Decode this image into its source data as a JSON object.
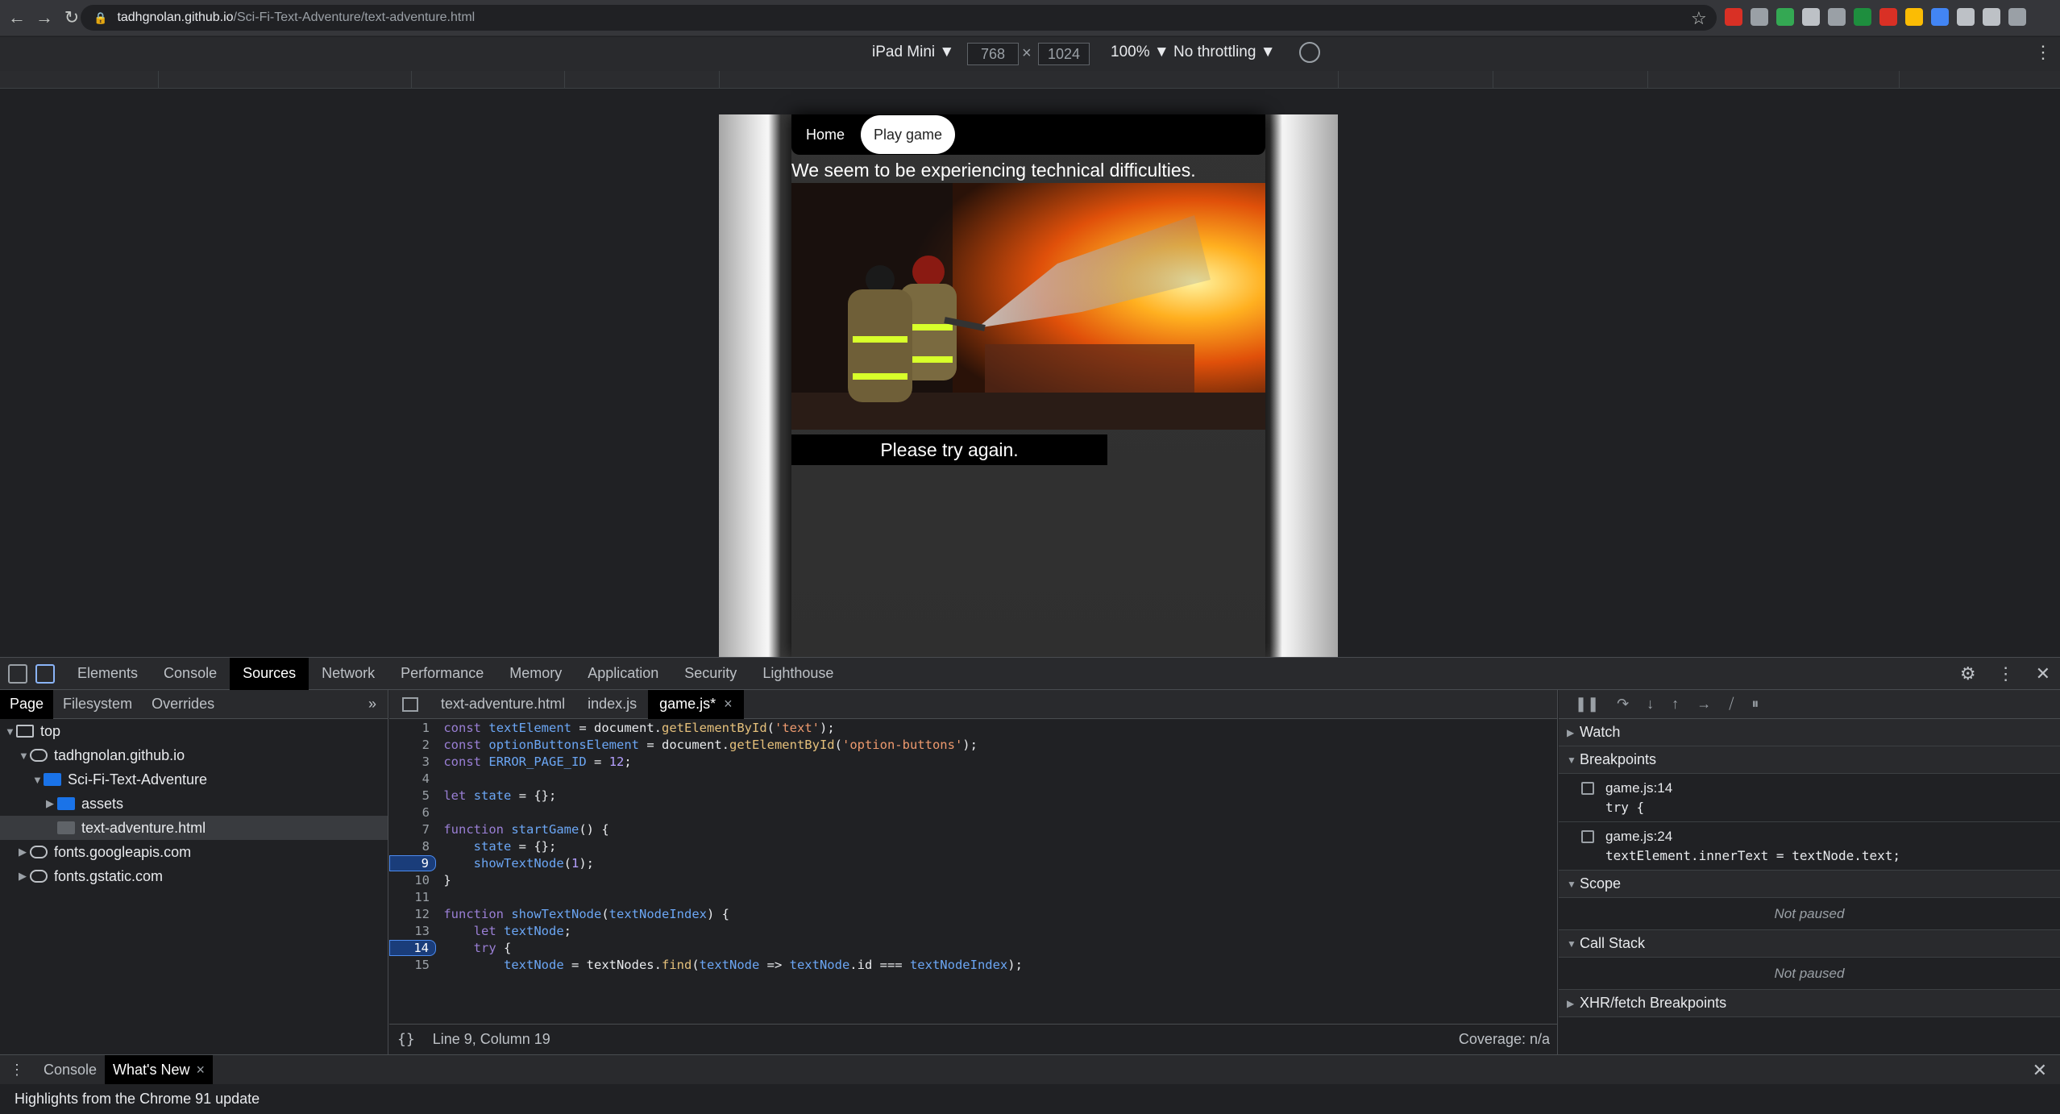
{
  "browser": {
    "url_host": "tadhgnolan.github.io",
    "url_path": "/Sci-Fi-Text-Adventure/text-adventure.html",
    "extension_colors": [
      "#d93025",
      "#9aa0a6",
      "#34a853",
      "#bdc1c6",
      "#9aa0a6",
      "#1e8e3e",
      "#d93025",
      "#fbbc04",
      "#4285f4",
      "#bdc1c6",
      "#bdc1c6",
      "#9aa0a6"
    ]
  },
  "device_toolbar": {
    "device": "iPad Mini ▼",
    "width": "768",
    "height": "1024",
    "times": "×",
    "zoom": "100% ▼",
    "throttling": "No throttling ▼"
  },
  "game": {
    "nav_home": "Home",
    "nav_play": "Play game",
    "message": "We seem to be experiencing technical difficulties.",
    "retry": "Please try again."
  },
  "devtools": {
    "tabs": [
      "Elements",
      "Console",
      "Sources",
      "Network",
      "Performance",
      "Memory",
      "Application",
      "Security",
      "Lighthouse"
    ],
    "active_tab": "Sources",
    "navigator_tabs": [
      "Page",
      "Filesystem",
      "Overrides",
      "»"
    ],
    "tree": [
      {
        "label": "top",
        "depth": 0,
        "icon": "frame",
        "arrow": "▼"
      },
      {
        "label": "tadhgnolan.github.io",
        "depth": 1,
        "icon": "cloud",
        "arrow": "▼"
      },
      {
        "label": "Sci-Fi-Text-Adventure",
        "depth": 2,
        "icon": "folder",
        "arrow": "▼"
      },
      {
        "label": "assets",
        "depth": 3,
        "icon": "folder",
        "arrow": "▶"
      },
      {
        "label": "text-adventure.html",
        "depth": 3,
        "icon": "file",
        "arrow": ""
      },
      {
        "label": "fonts.googleapis.com",
        "depth": 1,
        "icon": "cloud",
        "arrow": "▶"
      },
      {
        "label": "fonts.gstatic.com",
        "depth": 1,
        "icon": "cloud",
        "arrow": "▶"
      }
    ],
    "file_tabs": [
      "text-adventure.html",
      "index.js",
      "game.js*"
    ],
    "active_file": "game.js*",
    "code_lines": [
      {
        "n": "1",
        "code": "const textElement = document.getElementById('text');"
      },
      {
        "n": "2",
        "code": "const optionButtonsElement = document.getElementById('option-buttons');"
      },
      {
        "n": "3",
        "code": "const ERROR_PAGE_ID = 12;"
      },
      {
        "n": "4",
        "code": ""
      },
      {
        "n": "5",
        "code": "let state = {};"
      },
      {
        "n": "6",
        "code": ""
      },
      {
        "n": "7",
        "code": "function startGame() {"
      },
      {
        "n": "8",
        "code": "    state = {};"
      },
      {
        "n": "9",
        "code": "    showTextNode(1);",
        "bp": true
      },
      {
        "n": "10",
        "code": "}"
      },
      {
        "n": "11",
        "code": ""
      },
      {
        "n": "12",
        "code": "function showTextNode(textNodeIndex) {"
      },
      {
        "n": "13",
        "code": "    let textNode;"
      },
      {
        "n": "14",
        "code": "    try {",
        "bp": true
      },
      {
        "n": "15",
        "code": "        textNode = textNodes.find(textNode => textNode.id === textNodeIndex);"
      }
    ],
    "status_braces": "{}",
    "cursor_position": "Line 9, Column 19",
    "coverage": "Coverage: n/a",
    "debugger": {
      "watch": "Watch",
      "breakpoints": "Breakpoints",
      "bp_items": [
        {
          "file": "game.js:14",
          "snippet": "try {"
        },
        {
          "file": "game.js:24",
          "snippet": "textElement.innerText = textNode.text;"
        }
      ],
      "scope": "Scope",
      "scope_status": "Not paused",
      "call_stack": "Call Stack",
      "call_stack_status": "Not paused",
      "xhr": "XHR/fetch Breakpoints"
    },
    "drawer_tabs": [
      "Console",
      "What's New"
    ],
    "drawer_active": "What's New",
    "drawer_message": "Highlights from the Chrome 91 update"
  }
}
